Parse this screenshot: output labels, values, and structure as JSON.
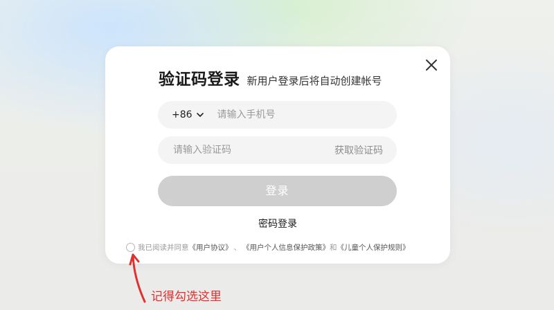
{
  "heading": {
    "title": "验证码登录",
    "subtitle": "新用户登录后将自动创建帐号"
  },
  "phone": {
    "country_code": "+86",
    "placeholder": "请输入手机号"
  },
  "code": {
    "placeholder": "请输入验证码",
    "get_code_label": "获取验证码"
  },
  "login_button": "登录",
  "password_login": "密码登录",
  "agreement": {
    "prefix": "我已阅读并同意",
    "terms": "《用户协议》",
    "sep1": "、",
    "privacy": "《用户个人信息保护政策》",
    "conj": "和",
    "children": "《儿童个人保护规则》"
  },
  "annotation": {
    "text": "记得勾选这里",
    "color": "#e03030"
  },
  "icons": {
    "close": "close-icon",
    "dropdown": "chevron-down-icon",
    "pointer": "arrow-up-icon"
  }
}
